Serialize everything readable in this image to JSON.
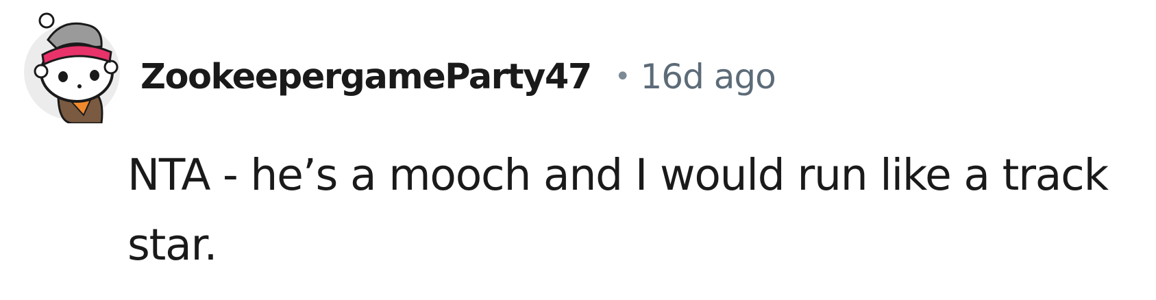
{
  "comment": {
    "avatar_icon": "snoo-avatar-icon",
    "username": "ZookeepergameParty47",
    "separator": "•",
    "timestamp": "16d ago",
    "body": "NTA - he’s a mooch and I would run like a track star."
  },
  "colors": {
    "text": "#1a1a1b",
    "meta": "#5c6b78",
    "avatar_bg": "#ececec",
    "bandana": "#e8326a"
  }
}
